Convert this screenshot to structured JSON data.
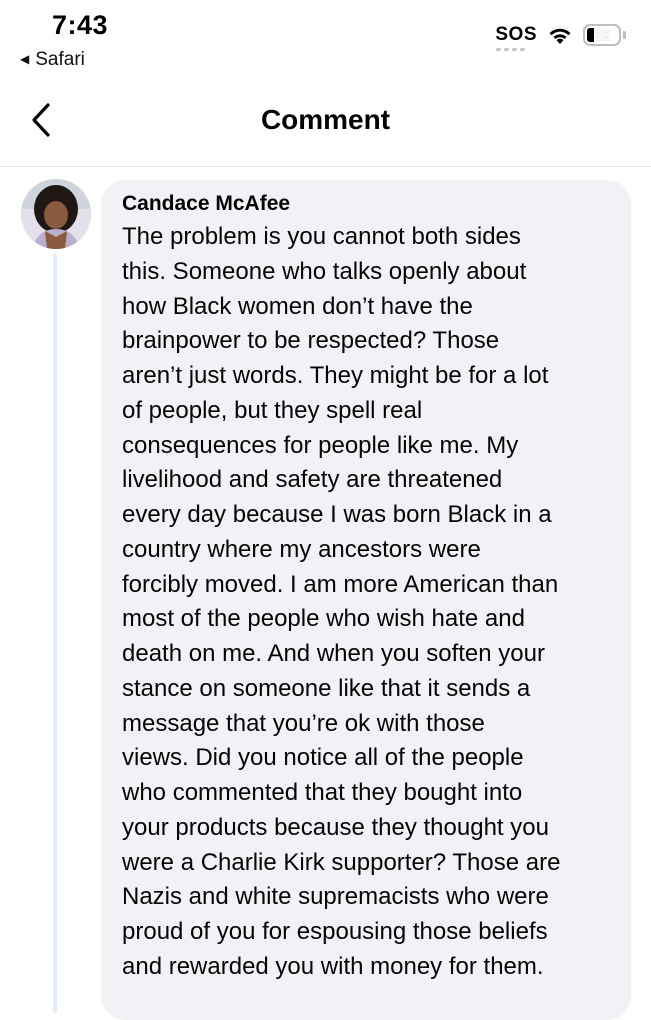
{
  "status_bar": {
    "time": "7:43",
    "back_app": "Safari",
    "sos": "SOS",
    "battery": "22"
  },
  "header": {
    "title": "Comment",
    "back_icon": "chevron-left-icon"
  },
  "comment": {
    "author": "Candace McAfee",
    "lines": [
      "The problem is you cannot both sides",
      "this. Someone who talks openly about",
      "how Black women don’t have the",
      "brainpower to be respected? Those",
      "aren’t just words. They might be for a lot",
      "of people, but they spell real",
      "consequences for people like me. My",
      "livelihood and safety are threatened",
      "every day because I was born Black in a",
      "country where my ancestors were",
      "forcibly moved. I am more American than",
      "most of the people who wish hate and",
      "death on me. And when you soften your",
      "stance on someone like that it sends a",
      "message that you’re ok with those",
      "views.  Did you notice all of the people",
      "who commented that they bought into",
      "your products because they thought you",
      "were a Charlie Kirk supporter? Those are",
      "Nazis and white supremacists who were",
      "proud of you for espousing those beliefs",
      "and rewarded you with money for them."
    ]
  }
}
